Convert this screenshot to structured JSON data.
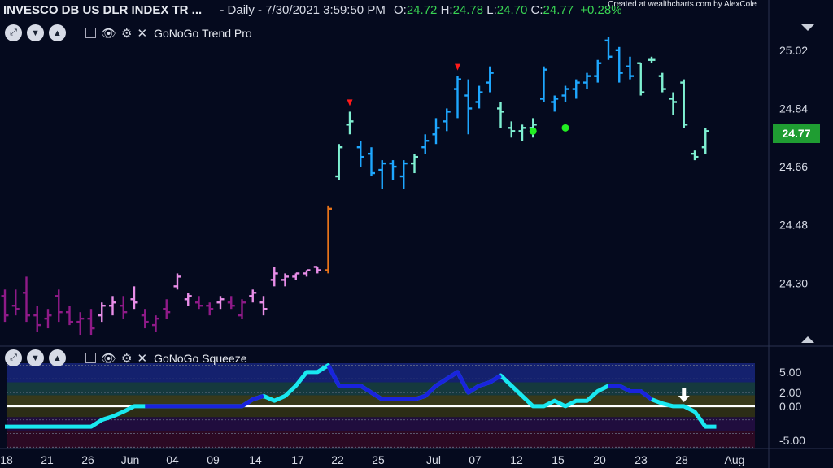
{
  "header": {
    "instrument": "INVESCO DB US DLR INDEX TR ...",
    "details": "- Daily - 7/30/2021 3:59:50 PM",
    "ohlc": [
      {
        "label": "O:",
        "value": "24.72"
      },
      {
        "label": "H:",
        "value": "24.78"
      },
      {
        "label": "L:",
        "value": "24.70"
      },
      {
        "label": "C:",
        "value": "24.77"
      }
    ],
    "change": "+0.28%",
    "credit": "Created at wealthcharts.com by AlexCole"
  },
  "panels": {
    "trend": {
      "label": "GoNoGo Trend Pro"
    },
    "squeeze": {
      "label": "GoNoGo Squeeze"
    }
  },
  "last_price": "24.77",
  "colors": {
    "background": "#050a1e",
    "go_strong": "#1ea7ff",
    "go_weak": "#7ff0d2",
    "amber": "#e8731a",
    "nogo_weak": "#e98ee8",
    "nogo_strong": "#8f1a88",
    "squeeze_line": "#19e8f0",
    "squeeze_dark": "#1a23dd",
    "badge": "#1f9d32"
  },
  "chart_data": [
    {
      "type": "ohlc",
      "title": "GoNoGo Trend Pro",
      "y_ticks": [
        "25.02",
        "24.84",
        "24.66",
        "24.48",
        "24.30"
      ],
      "ylim": [
        24.12,
        25.12
      ],
      "x_ticks": [
        "18",
        "21",
        "26",
        "Jun",
        "04",
        "09",
        "14",
        "17",
        "22",
        "25",
        "Jul",
        "07",
        "12",
        "15",
        "20",
        "23",
        "28",
        "Aug"
      ],
      "bars": [
        {
          "o": 24.26,
          "h": 24.28,
          "l": 24.18,
          "c": 24.2,
          "color": "nogo_strong"
        },
        {
          "o": 24.23,
          "h": 24.28,
          "l": 24.2,
          "c": 24.22,
          "color": "nogo_strong"
        },
        {
          "o": 24.27,
          "h": 24.32,
          "l": 24.18,
          "c": 24.2,
          "color": "nogo_strong"
        },
        {
          "o": 24.2,
          "h": 24.23,
          "l": 24.15,
          "c": 24.17,
          "color": "nogo_strong"
        },
        {
          "o": 24.19,
          "h": 24.22,
          "l": 24.16,
          "c": 24.2,
          "color": "nogo_strong"
        },
        {
          "o": 24.26,
          "h": 24.28,
          "l": 24.18,
          "c": 24.21,
          "color": "nogo_strong"
        },
        {
          "o": 24.21,
          "h": 24.23,
          "l": 24.17,
          "c": 24.18,
          "color": "nogo_strong"
        },
        {
          "o": 24.18,
          "h": 24.21,
          "l": 24.14,
          "c": 24.19,
          "color": "nogo_strong"
        },
        {
          "o": 24.19,
          "h": 24.22,
          "l": 24.14,
          "c": 24.16,
          "color": "nogo_strong"
        },
        {
          "o": 24.2,
          "h": 24.24,
          "l": 24.18,
          "c": 24.23,
          "color": "nogo_weak"
        },
        {
          "o": 24.23,
          "h": 24.26,
          "l": 24.2,
          "c": 24.24,
          "color": "nogo_weak"
        },
        {
          "o": 24.23,
          "h": 24.26,
          "l": 24.19,
          "c": 24.21,
          "color": "nogo_strong"
        },
        {
          "o": 24.25,
          "h": 24.29,
          "l": 24.22,
          "c": 24.24,
          "color": "nogo_weak"
        },
        {
          "o": 24.2,
          "h": 24.22,
          "l": 24.16,
          "c": 24.18,
          "color": "nogo_strong"
        },
        {
          "o": 24.17,
          "h": 24.2,
          "l": 24.15,
          "c": 24.19,
          "color": "nogo_strong"
        },
        {
          "o": 24.22,
          "h": 24.25,
          "l": 24.19,
          "c": 24.21,
          "color": "nogo_strong"
        },
        {
          "o": 24.29,
          "h": 24.33,
          "l": 24.28,
          "c": 24.32,
          "color": "nogo_weak"
        },
        {
          "o": 24.25,
          "h": 24.27,
          "l": 24.23,
          "c": 24.26,
          "color": "nogo_weak"
        },
        {
          "o": 24.24,
          "h": 24.26,
          "l": 24.22,
          "c": 24.23,
          "color": "nogo_strong"
        },
        {
          "o": 24.23,
          "h": 24.24,
          "l": 24.2,
          "c": 24.22,
          "color": "nogo_strong"
        },
        {
          "o": 24.24,
          "h": 24.26,
          "l": 24.22,
          "c": 24.25,
          "color": "nogo_weak"
        },
        {
          "o": 24.24,
          "h": 24.26,
          "l": 24.22,
          "c": 24.23,
          "color": "nogo_strong"
        },
        {
          "o": 24.2,
          "h": 24.25,
          "l": 24.19,
          "c": 24.24,
          "color": "nogo_strong"
        },
        {
          "o": 24.26,
          "h": 24.28,
          "l": 24.24,
          "c": 24.27,
          "color": "nogo_weak"
        },
        {
          "o": 24.24,
          "h": 24.26,
          "l": 24.2,
          "c": 24.22,
          "color": "nogo_weak"
        },
        {
          "o": 24.31,
          "h": 24.35,
          "l": 24.29,
          "c": 24.33,
          "color": "nogo_weak"
        },
        {
          "o": 24.31,
          "h": 24.33,
          "l": 24.29,
          "c": 24.32,
          "color": "nogo_weak"
        },
        {
          "o": 24.32,
          "h": 24.33,
          "l": 24.31,
          "c": 24.33,
          "color": "nogo_weak"
        },
        {
          "o": 24.33,
          "h": 24.34,
          "l": 24.32,
          "c": 24.34,
          "color": "nogo_weak"
        },
        {
          "o": 24.35,
          "h": 24.35,
          "l": 24.33,
          "c": 24.34,
          "color": "nogo_weak"
        },
        {
          "o": 24.34,
          "h": 24.54,
          "l": 24.33,
          "c": 24.53,
          "color": "amber"
        },
        {
          "o": 24.63,
          "h": 24.73,
          "l": 24.62,
          "c": 24.72,
          "color": "go_weak"
        },
        {
          "o": 24.79,
          "h": 24.83,
          "l": 24.76,
          "c": 24.8,
          "color": "go_weak"
        },
        {
          "o": 24.72,
          "h": 24.74,
          "l": 24.66,
          "c": 24.69,
          "color": "go_strong"
        },
        {
          "o": 24.7,
          "h": 24.72,
          "l": 24.63,
          "c": 24.64,
          "color": "go_strong"
        },
        {
          "o": 24.65,
          "h": 24.68,
          "l": 24.59,
          "c": 24.67,
          "color": "go_strong"
        },
        {
          "o": 24.67,
          "h": 24.68,
          "l": 24.62,
          "c": 24.66,
          "color": "go_strong"
        },
        {
          "o": 24.63,
          "h": 24.68,
          "l": 24.59,
          "c": 24.67,
          "color": "go_strong"
        },
        {
          "o": 24.67,
          "h": 24.7,
          "l": 24.64,
          "c": 24.69,
          "color": "go_weak"
        },
        {
          "o": 24.72,
          "h": 24.76,
          "l": 24.7,
          "c": 24.74,
          "color": "go_strong"
        },
        {
          "o": 24.76,
          "h": 24.81,
          "l": 24.73,
          "c": 24.78,
          "color": "go_strong"
        },
        {
          "o": 24.8,
          "h": 24.84,
          "l": 24.77,
          "c": 24.83,
          "color": "go_strong"
        },
        {
          "o": 24.9,
          "h": 24.94,
          "l": 24.81,
          "c": 24.93,
          "color": "go_strong"
        },
        {
          "o": 24.88,
          "h": 24.93,
          "l": 24.76,
          "c": 24.84,
          "color": "go_strong"
        },
        {
          "o": 24.86,
          "h": 24.91,
          "l": 24.84,
          "c": 24.89,
          "color": "go_strong"
        },
        {
          "o": 24.92,
          "h": 24.97,
          "l": 24.89,
          "c": 24.95,
          "color": "go_strong"
        },
        {
          "o": 24.84,
          "h": 24.86,
          "l": 24.78,
          "c": 24.83,
          "color": "go_weak"
        },
        {
          "o": 24.78,
          "h": 24.8,
          "l": 24.75,
          "c": 24.77,
          "color": "go_weak"
        },
        {
          "o": 24.77,
          "h": 24.79,
          "l": 24.74,
          "c": 24.78,
          "color": "go_weak"
        },
        {
          "o": 24.78,
          "h": 24.81,
          "l": 24.75,
          "c": 24.79,
          "color": "go_weak"
        },
        {
          "o": 24.87,
          "h": 24.97,
          "l": 24.86,
          "c": 24.96,
          "color": "go_strong"
        },
        {
          "o": 24.86,
          "h": 24.88,
          "l": 24.83,
          "c": 24.87,
          "color": "go_strong"
        },
        {
          "o": 24.88,
          "h": 24.91,
          "l": 24.86,
          "c": 24.9,
          "color": "go_strong"
        },
        {
          "o": 24.9,
          "h": 24.93,
          "l": 24.87,
          "c": 24.92,
          "color": "go_strong"
        },
        {
          "o": 24.92,
          "h": 24.95,
          "l": 24.9,
          "c": 24.94,
          "color": "go_strong"
        },
        {
          "o": 24.94,
          "h": 24.99,
          "l": 24.92,
          "c": 24.98,
          "color": "go_strong"
        },
        {
          "o": 25.05,
          "h": 25.06,
          "l": 24.99,
          "c": 25.0,
          "color": "go_strong"
        },
        {
          "o": 25.02,
          "h": 25.03,
          "l": 24.92,
          "c": 24.95,
          "color": "go_strong"
        },
        {
          "o": 24.97,
          "h": 25.0,
          "l": 24.93,
          "c": 24.94,
          "color": "go_strong"
        },
        {
          "o": 24.98,
          "h": 24.98,
          "l": 24.88,
          "c": 24.89,
          "color": "go_weak"
        },
        {
          "o": 24.99,
          "h": 25.0,
          "l": 24.98,
          "c": 24.99,
          "color": "go_weak"
        },
        {
          "o": 24.94,
          "h": 24.95,
          "l": 24.89,
          "c": 24.9,
          "color": "go_weak"
        },
        {
          "o": 24.87,
          "h": 24.89,
          "l": 24.82,
          "c": 24.86,
          "color": "go_weak"
        },
        {
          "o": 24.92,
          "h": 24.93,
          "l": 24.78,
          "c": 24.79,
          "color": "go_weak"
        },
        {
          "o": 24.7,
          "h": 24.71,
          "l": 24.68,
          "c": 24.69,
          "color": "go_weak"
        },
        {
          "o": 24.72,
          "h": 24.78,
          "l": 24.7,
          "c": 24.77,
          "color": "go_weak"
        }
      ],
      "nogo_markers": [
        32,
        42
      ],
      "go_dots": [
        [
          49,
          24.79
        ],
        [
          52,
          24.8
        ]
      ]
    },
    {
      "type": "line",
      "title": "GoNoGo Squeeze",
      "y_ticks": [
        "5.00",
        "2.00",
        "0.00",
        "-5.00"
      ],
      "ylim": [
        -6.2,
        6.3
      ],
      "zero_line": 0,
      "values": [
        -3,
        -3,
        -3,
        -3,
        -3,
        -3,
        -3,
        -3,
        -3,
        -2,
        -1.5,
        -0.8,
        0,
        0,
        0,
        0,
        0,
        0,
        0,
        0,
        0,
        0,
        0,
        1,
        1.5,
        0.8,
        1.5,
        3,
        5,
        5,
        6,
        3,
        3,
        3,
        2,
        1,
        1,
        1,
        1,
        1.5,
        3,
        4,
        5,
        2,
        3,
        3.5,
        4.5,
        3,
        1.5,
        0,
        0,
        0.8,
        0,
        0.8,
        0.8,
        2.2,
        3,
        3,
        2.2,
        2.2,
        1,
        0.4,
        0,
        0,
        -0.8,
        -3,
        -3
      ],
      "dark_segments": [
        [
          13,
          24
        ],
        [
          30,
          46
        ],
        [
          56,
          60
        ]
      ],
      "signal_arrow_index": 63
    }
  ]
}
